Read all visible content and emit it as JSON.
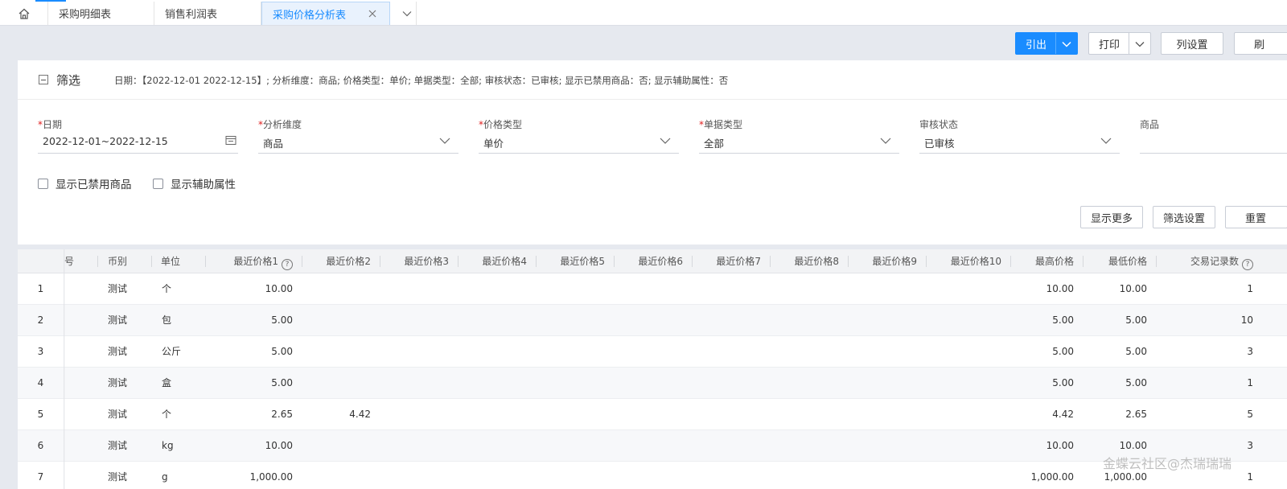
{
  "tabs": [
    {
      "label": "采购明细表"
    },
    {
      "label": "销售利润表"
    },
    {
      "label": "采购价格分析表"
    }
  ],
  "toolbar": {
    "export_label": "引出",
    "print_label": "打印",
    "columns_label": "列设置",
    "refresh_label": "刷"
  },
  "filter": {
    "title": "筛选",
    "summary": "日期：【2022-12-01 2022-12-15】; 分析维度：商品; 价格类型：单价; 单据类型：全部; 审核状态：已审核; 显示已禁用商品：否; 显示辅助属性：否",
    "fields": {
      "date": {
        "label": "日期",
        "value": "2022-12-01~2022-12-15"
      },
      "dimension": {
        "label": "分析维度",
        "value": "商品"
      },
      "price_type": {
        "label": "价格类型",
        "value": "单价"
      },
      "doc_type": {
        "label": "单据类型",
        "value": "全部"
      },
      "audit": {
        "label": "审核状态",
        "value": "已审核"
      },
      "product": {
        "label": "商品",
        "value": ""
      }
    },
    "required_mark": "*",
    "checkboxes": {
      "disabled_products": "显示已禁用商品",
      "aux_attr": "显示辅助属性"
    },
    "buttons": {
      "more": "显示更多",
      "settings": "筛选设置",
      "reset": "重置"
    }
  },
  "grid": {
    "headers": {
      "no": "号",
      "currency": "币别",
      "unit": "单位",
      "p1": "最近价格1",
      "p2": "最近价格2",
      "p3": "最近价格3",
      "p4": "最近价格4",
      "p5": "最近价格5",
      "p6": "最近价格6",
      "p7": "最近价格7",
      "p8": "最近价格8",
      "p9": "最近价格9",
      "p10": "最近价格10",
      "max": "最高价格",
      "min": "最低价格",
      "count": "交易记录数"
    },
    "help_glyph": "?",
    "rows": [
      {
        "idx": "1",
        "currency": "测试",
        "unit": "个",
        "p1": "10.00",
        "p2": "",
        "max": "10.00",
        "min": "10.00",
        "count": "1"
      },
      {
        "idx": "2",
        "currency": "测试",
        "unit": "包",
        "p1": "5.00",
        "p2": "",
        "max": "5.00",
        "min": "5.00",
        "count": "10"
      },
      {
        "idx": "3",
        "currency": "测试",
        "unit": "公斤",
        "p1": "5.00",
        "p2": "",
        "max": "5.00",
        "min": "5.00",
        "count": "3"
      },
      {
        "idx": "4",
        "currency": "测试",
        "unit": "盒",
        "p1": "5.00",
        "p2": "",
        "max": "5.00",
        "min": "5.00",
        "count": "1"
      },
      {
        "idx": "5",
        "currency": "测试",
        "unit": "个",
        "p1": "2.65",
        "p2": "4.42",
        "max": "4.42",
        "min": "2.65",
        "count": "5"
      },
      {
        "idx": "6",
        "currency": "测试",
        "unit": "kg",
        "p1": "10.00",
        "p2": "",
        "max": "10.00",
        "min": "10.00",
        "count": "3"
      },
      {
        "idx": "7",
        "currency": "测试",
        "unit": "g",
        "p1": "1,000.00",
        "p2": "",
        "max": "1,000.00",
        "min": "1,000.00",
        "count": "1"
      }
    ]
  },
  "watermark": "金蝶云社区@杰瑞瑞瑞",
  "colors": {
    "accent": "#1a8cff",
    "required": "#e02020",
    "background": "#e6e9ef"
  }
}
